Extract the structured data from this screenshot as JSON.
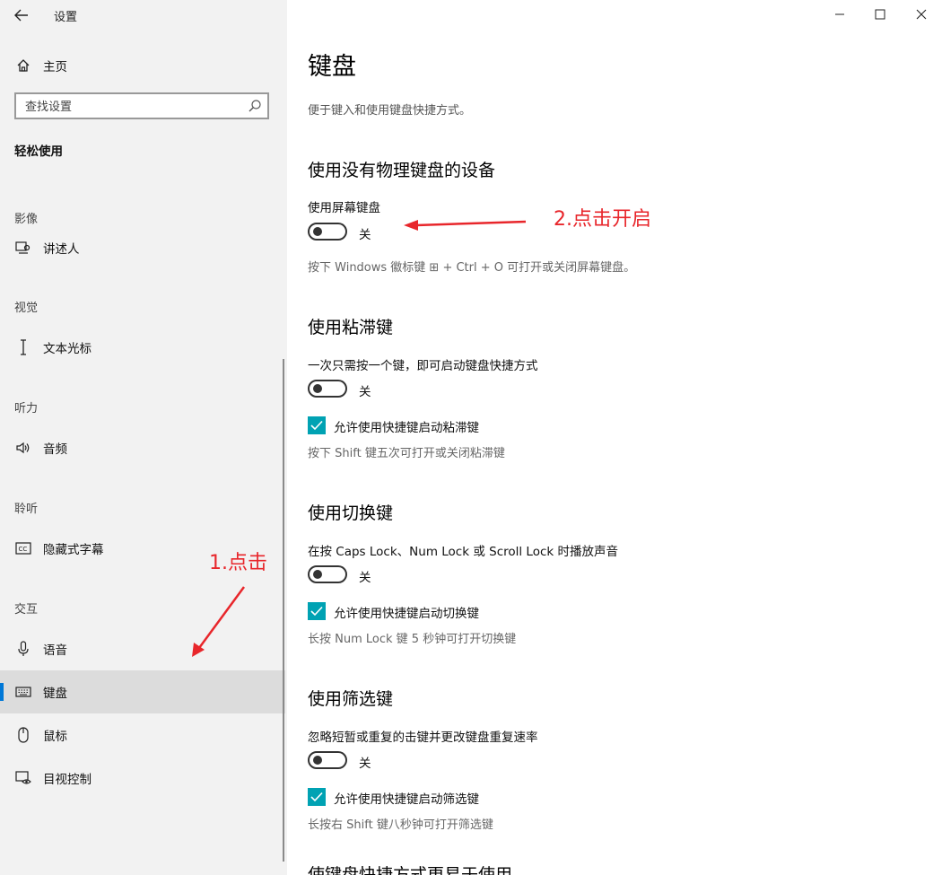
{
  "window": {
    "title": "设置"
  },
  "sidebar": {
    "home_label": "主页",
    "search_placeholder": "查找设置",
    "category_title": "轻松使用",
    "groups": [
      {
        "label": "影像",
        "items": [
          {
            "label": "讲述人",
            "icon": "narrator-icon"
          }
        ]
      },
      {
        "label": "视觉",
        "items": [
          {
            "label": "文本光标",
            "icon": "text-cursor-icon"
          }
        ]
      },
      {
        "label": "听力",
        "items": [
          {
            "label": "音频",
            "icon": "speaker-icon"
          }
        ]
      },
      {
        "label": "聆听",
        "items": [
          {
            "label": "隐藏式字幕",
            "icon": "closed-captions-icon"
          }
        ]
      },
      {
        "label": "交互",
        "items": [
          {
            "label": "语音",
            "icon": "microphone-icon"
          },
          {
            "label": "键盘",
            "icon": "keyboard-icon",
            "selected": true
          },
          {
            "label": "鼠标",
            "icon": "mouse-icon"
          },
          {
            "label": "目视控制",
            "icon": "eye-control-icon"
          }
        ]
      }
    ]
  },
  "main": {
    "title": "键盘",
    "description": "便于键入和使用键盘快捷方式。",
    "sections": [
      {
        "title": "使用没有物理键盘的设备",
        "option_label": "使用屏幕键盘",
        "toggle_state": "关",
        "hint": "按下 Windows 徽标键 ⊞ + Ctrl + O 可打开或关闭屏幕键盘。"
      },
      {
        "title": "使用粘滞键",
        "option_label": "一次只需按一个键，即可启动键盘快捷方式",
        "toggle_state": "关",
        "checkbox_label": "允许使用快捷键启动粘滞键",
        "hint": "按下 Shift 键五次可打开或关闭粘滞键"
      },
      {
        "title": "使用切换键",
        "option_label": "在按 Caps Lock、Num Lock 或 Scroll Lock 时播放声音",
        "toggle_state": "关",
        "checkbox_label": "允许使用快捷键启动切换键",
        "hint": "长按 Num Lock 键 5 秒钟可打开切换键"
      },
      {
        "title": "使用筛选键",
        "option_label": "忽略短暂或重复的击键并更改键盘重复速率",
        "toggle_state": "关",
        "checkbox_label": "允许使用快捷键启动筛选键",
        "hint": "长按右 Shift 键八秒钟可打开筛选键"
      }
    ],
    "cut_off_title": "使键盘快捷方式更易于使用"
  },
  "annotations": {
    "step1": "1.点击",
    "step2": "2.点击开启",
    "color": "#e8262b"
  },
  "colors": {
    "accent": "#0078d7",
    "checkbox": "#00a2b3",
    "sidebar_bg": "#f2f2f2",
    "selected_bg": "#dcdcdc"
  }
}
